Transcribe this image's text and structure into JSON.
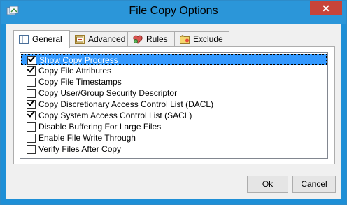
{
  "window": {
    "title": "File Copy Options"
  },
  "tabs": [
    {
      "label": "General",
      "icon": "grid-icon"
    },
    {
      "label": "Advanced",
      "icon": "advanced-icon"
    },
    {
      "label": "Rules",
      "icon": "rules-icon"
    },
    {
      "label": "Exclude",
      "icon": "exclude-icon"
    }
  ],
  "options": [
    {
      "label": "Show Copy Progress",
      "checked": true,
      "selected": true
    },
    {
      "label": "Copy File Attributes",
      "checked": true
    },
    {
      "label": "Copy File Timestamps",
      "checked": false
    },
    {
      "label": "Copy User/Group Security Descriptor",
      "checked": false
    },
    {
      "label": "Copy Discretionary Access Control List (DACL)",
      "checked": true
    },
    {
      "label": "Copy System Access Control List (SACL)",
      "checked": true
    },
    {
      "label": "Disable Buffering For Large Files",
      "checked": false
    },
    {
      "label": "Enable File Write Through",
      "checked": false
    },
    {
      "label": "Verify Files After Copy",
      "checked": false
    }
  ],
  "buttons": {
    "ok": "Ok",
    "cancel": "Cancel"
  },
  "colors": {
    "titlebar": "#2b96d9",
    "close": "#c7443a",
    "selection": "#3399ff"
  }
}
